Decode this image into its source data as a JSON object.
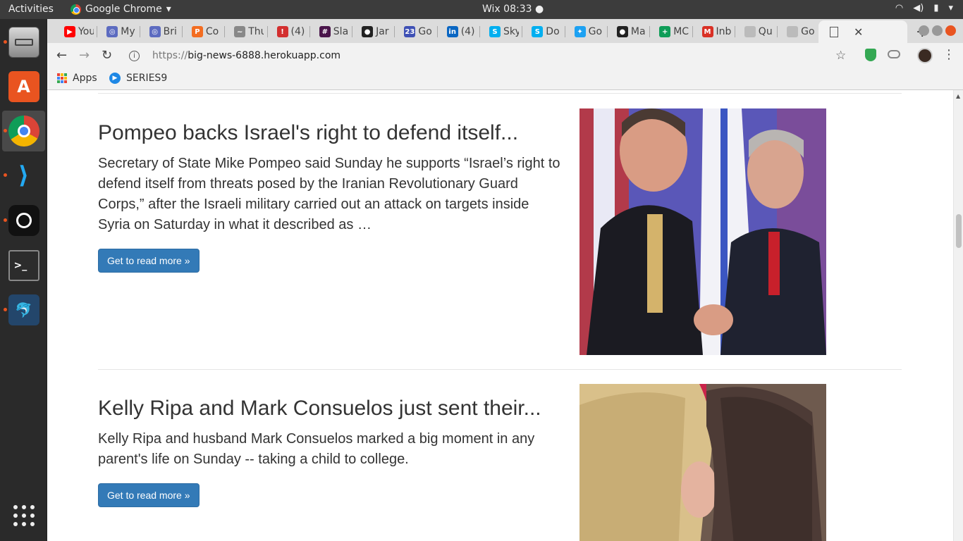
{
  "system": {
    "activities": "Activities",
    "app_name": "Google Chrome",
    "clock": "Wix 08:33"
  },
  "tabs": [
    {
      "label": "You",
      "icon": "youtube-icon",
      "color": "#ff0000"
    },
    {
      "label": "My",
      "icon": "globe-icon",
      "color": "#5c6bc0"
    },
    {
      "label": "Bri",
      "icon": "globe-icon",
      "color": "#5c6bc0"
    },
    {
      "label": "Co",
      "icon": "p-icon",
      "color": "#f36d21"
    },
    {
      "label": "Thu",
      "icon": "leaf-icon",
      "color": "#888888"
    },
    {
      "label": "(4)",
      "icon": "alert-icon",
      "color": "#d32f2f"
    },
    {
      "label": "Sla",
      "icon": "slack-icon",
      "color": "#4a154b"
    },
    {
      "label": "Jar",
      "icon": "github-icon",
      "color": "#222222"
    },
    {
      "label": "Go",
      "icon": "calendar-icon",
      "color": "#3f51b5"
    },
    {
      "label": "(4)",
      "icon": "linkedin-icon",
      "color": "#0a66c2"
    },
    {
      "label": "Sky",
      "icon": "skype-icon",
      "color": "#00aff0"
    },
    {
      "label": "Do",
      "icon": "skype-icon",
      "color": "#00aff0"
    },
    {
      "label": "Go",
      "icon": "twitter-icon",
      "color": "#1da1f2"
    },
    {
      "label": "Ma",
      "icon": "github-icon",
      "color": "#222222"
    },
    {
      "label": "MC",
      "icon": "plus-icon",
      "color": "#0f9d58"
    },
    {
      "label": "Inb",
      "icon": "gmail-icon",
      "color": "#d93025"
    },
    {
      "label": "Qu",
      "icon": "page-icon",
      "color": "#bbbbbb"
    },
    {
      "label": "Go",
      "icon": "page-icon",
      "color": "#bbbbbb"
    }
  ],
  "active_tab": {
    "icon": "page-icon",
    "close": "✕"
  },
  "omnibox": {
    "scheme": "https://",
    "host": "big-news-6888.herokuapp.com"
  },
  "bookmarks": [
    {
      "label": "Apps",
      "icon": "apps-grid-icon"
    },
    {
      "label": "SERIES9",
      "icon": "series9-icon"
    }
  ],
  "articles": [
    {
      "title": "Pompeo backs Israel's right to defend itself...",
      "summary": "Secretary of State Mike Pompeo said Sunday he supports “Israel’s right to defend itself from threats posed by the Iranian Revolutionary Guard Corps,” after the Israeli military carried out an attack on targets inside Syria on Saturday in what it described as …",
      "button": "Get to read more »"
    },
    {
      "title": "Kelly Ripa and Mark Consuelos just sent their...",
      "summary": "Kelly Ripa and husband Mark Consuelos marked a big moment in any parent's life on Sunday -- taking a child to college.",
      "button": "Get to read more »"
    }
  ],
  "colors": {
    "button_bg": "#337ab7",
    "text": "#333333",
    "ubuntu_orange": "#e95420"
  }
}
